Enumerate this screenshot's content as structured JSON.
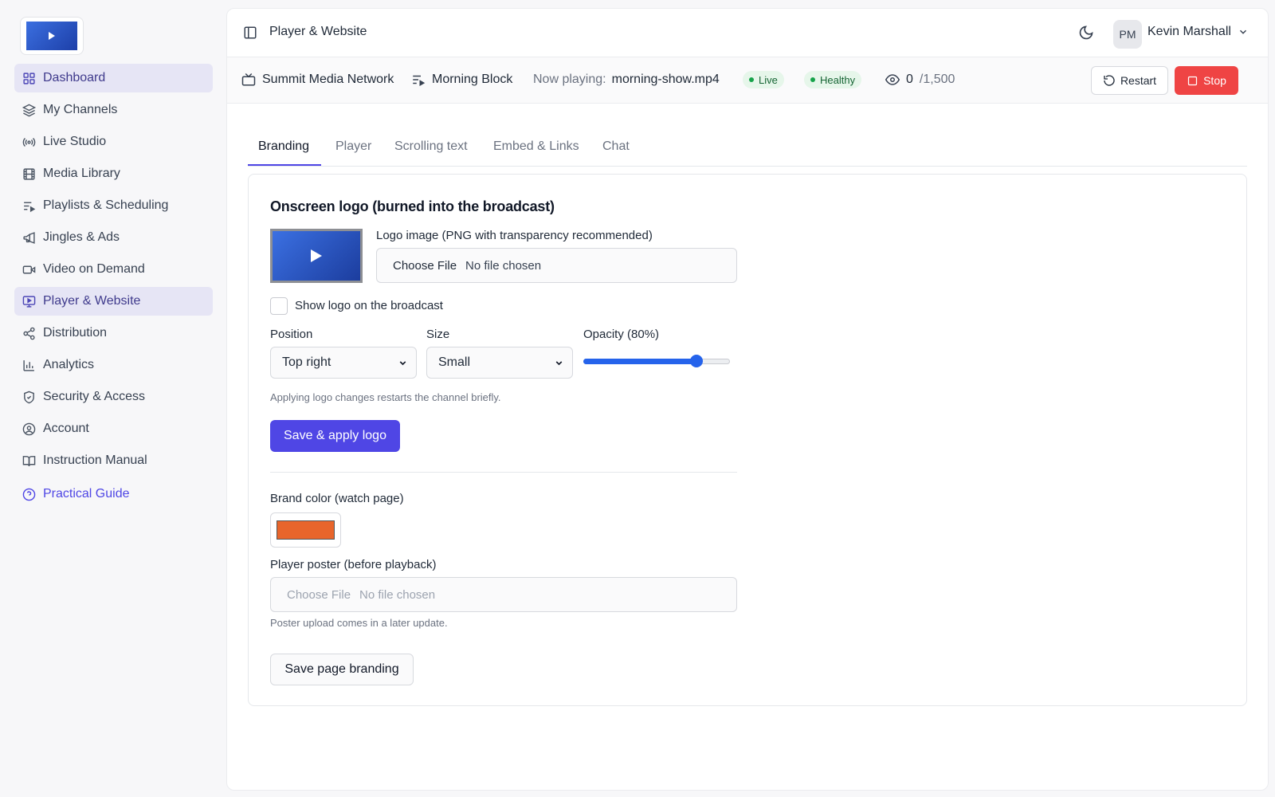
{
  "sidebar": {
    "logo_icon": "play-icon",
    "items": [
      {
        "label": "Dashboard",
        "icon": "grid-icon",
        "active": true
      },
      {
        "label": "My Channels",
        "icon": "layers-icon"
      },
      {
        "label": "Live Studio",
        "icon": "broadcast-icon"
      },
      {
        "label": "Media Library",
        "icon": "film-icon"
      },
      {
        "label": "Playlists & Scheduling",
        "icon": "playlist-icon"
      },
      {
        "label": "Jingles & Ads",
        "icon": "megaphone-icon"
      },
      {
        "label": "Video on Demand",
        "icon": "video-icon"
      },
      {
        "label": "Player & Website",
        "icon": "monitor-icon",
        "active": true
      },
      {
        "label": "Distribution",
        "icon": "share-icon"
      },
      {
        "label": "Analytics",
        "icon": "bar-chart-icon"
      },
      {
        "label": "Security & Access",
        "icon": "shield-icon"
      },
      {
        "label": "Account",
        "icon": "user-circle-icon"
      },
      {
        "label": "Instruction Manual",
        "icon": "book-icon"
      }
    ],
    "guide": {
      "label": "Practical Guide",
      "icon": "help-circle-icon"
    }
  },
  "header": {
    "title": "Player & Website",
    "avatar_initials": "PM",
    "user_name": "Kevin Marshall"
  },
  "status": {
    "network": "Summit Media Network",
    "block": "Morning Block",
    "now_playing_label": "Now playing:",
    "now_playing_file": "morning-show.mp4",
    "live": "Live",
    "health": "Healthy",
    "viewers": "0",
    "capacity": "/1,500",
    "restart_label": "Restart",
    "stop_label": "Stop"
  },
  "tabs": [
    "Branding",
    "Player",
    "Scrolling text",
    "Embed & Links",
    "Chat"
  ],
  "active_tab": 0,
  "branding": {
    "section_title": "Onscreen logo (burned into the broadcast)",
    "logo_label": "Logo image (PNG with transparency recommended)",
    "file_button": "Choose File",
    "file_status": "No file chosen",
    "show_logo_label": "Show logo on the broadcast",
    "show_logo_checked": false,
    "position_label": "Position",
    "position_value": "Top right",
    "size_label": "Size",
    "size_value": "Small",
    "opacity_label": "Opacity (80%)",
    "opacity_value": 0.8,
    "restart_hint": "Applying logo changes restarts the channel briefly.",
    "save_logo_label": "Save & apply logo",
    "brand_color_label": "Brand color (watch page)",
    "brand_color": "#e8652b",
    "poster_label": "Player poster (before playback)",
    "poster_file_button": "Choose File",
    "poster_file_status": "No file chosen",
    "poster_hint": "Poster upload comes in a later update.",
    "save_page_label": "Save page branding"
  },
  "colors": {
    "accent": "#4f46e5",
    "danger": "#ef4444",
    "success": "#16a34a"
  }
}
